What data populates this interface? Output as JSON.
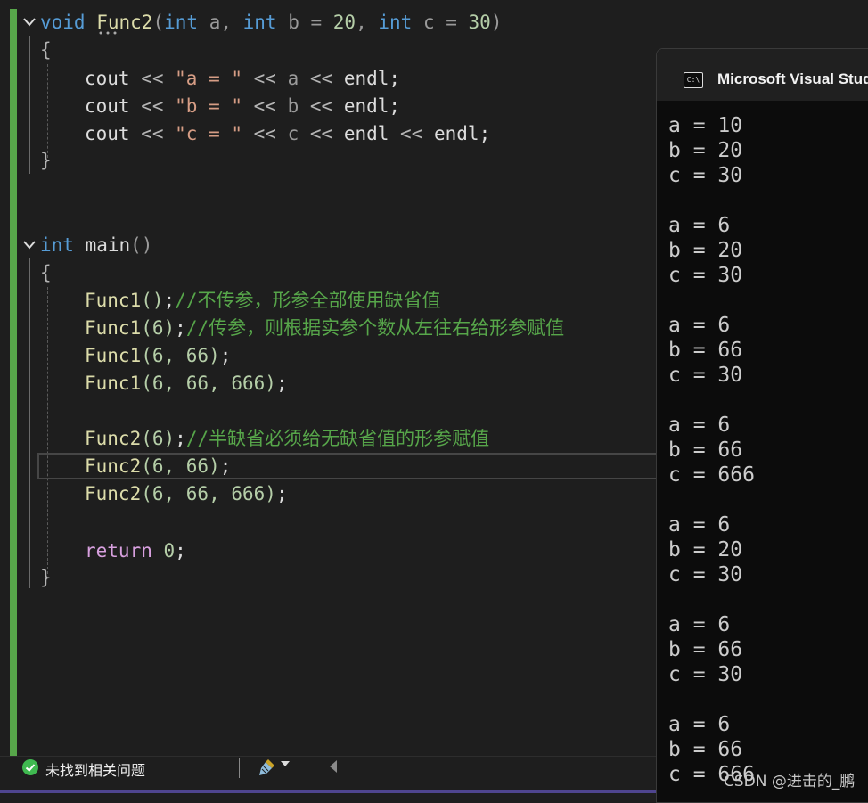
{
  "top_strip": {
    "text": "(...)"
  },
  "editor": {
    "func2_header": {
      "kw_void": "void",
      "name": "Func2",
      "open": "(",
      "p1_type": "int",
      "p1_name": " a, ",
      "p2_type": "int",
      "p2_rest": " b = ",
      "p2_val": "20",
      "comma2": ", ",
      "p3_type": "int",
      "p3_rest": " c = ",
      "p3_val": "30",
      "close": ")"
    },
    "brace_open": "{",
    "brace_close": "}",
    "cout_lines": [
      {
        "cout": "cout",
        "op1": " << ",
        "str": "\"a = \"",
        "op2": " << ",
        "var": "a",
        "op3": " << ",
        "endl": "endl",
        "tail": ";"
      },
      {
        "cout": "cout",
        "op1": " << ",
        "str": "\"b = \"",
        "op2": " << ",
        "var": "b",
        "op3": " << ",
        "endl": "endl",
        "tail": ";"
      },
      {
        "cout": "cout",
        "op1": " << ",
        "str": "\"c = \"",
        "op2": " << ",
        "var": "c",
        "op3": " << ",
        "endl": "endl",
        "mid": " << ",
        "endl2": "endl",
        "tail": ";"
      }
    ],
    "main_header": {
      "kw_int": "int",
      "name": " main",
      "parens": "()"
    },
    "main_lines": [
      {
        "call": "Func1",
        "args": "()",
        "semi": ";",
        "comment": "//不传参，形参全部使用缺省值"
      },
      {
        "call": "Func1",
        "args": "(6)",
        "semi": ";",
        "comment": "//传参，则根据实参个数从左往右给形参赋值"
      },
      {
        "call": "Func1",
        "args": "(6, 66)",
        "semi": ";",
        "comment": ""
      },
      {
        "call": "Func1",
        "args": "(6, 66, 666)",
        "semi": ";",
        "comment": ""
      },
      {
        "call": "Func2",
        "args": "(6)",
        "semi": ";",
        "comment": "//半缺省必须给无缺省值的形参赋值"
      },
      {
        "call": "Func2",
        "args": "(6, 66)",
        "semi": ";",
        "comment": ""
      },
      {
        "call": "Func2",
        "args": "(6, 66, 666)",
        "semi": ";",
        "comment": ""
      }
    ],
    "return_line": {
      "kw": "return",
      "val": " 0",
      "semi": ";"
    }
  },
  "status": {
    "message": "未找到相关问题"
  },
  "console": {
    "title": "Microsoft Visual Studio Debug Console",
    "lines": [
      "a = 10",
      "b = 20",
      "c = 30",
      "",
      "a = 6",
      "b = 20",
      "c = 30",
      "",
      "a = 6",
      "b = 66",
      "c = 30",
      "",
      "a = 6",
      "b = 66",
      "c = 666",
      "",
      "a = 6",
      "b = 20",
      "c = 30",
      "",
      "a = 6",
      "b = 66",
      "c = 30",
      "",
      "a = 6",
      "b = 66",
      "c = 666"
    ]
  },
  "watermark": "CSDN @进击的_鹏"
}
